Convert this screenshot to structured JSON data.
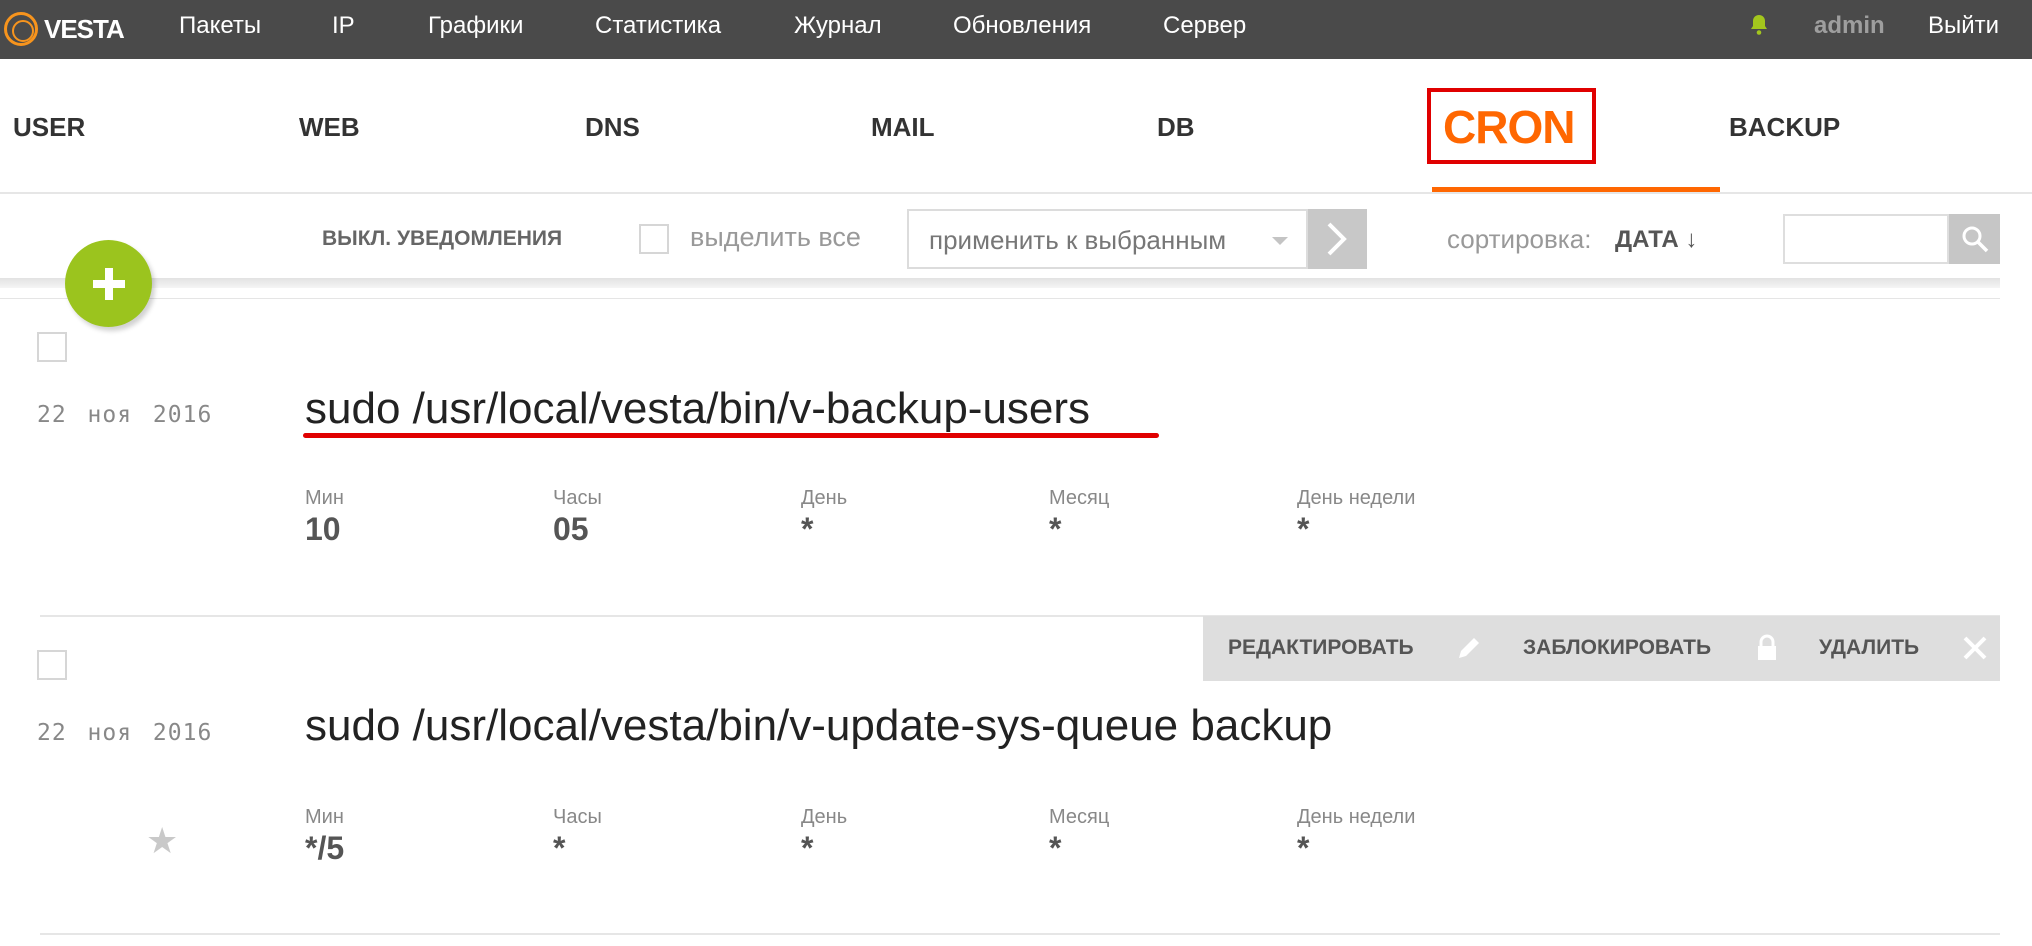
{
  "topbar": {
    "logo_text": "VESTA",
    "nav": [
      "Пакеты",
      "IP",
      "Графики",
      "Статистика",
      "Журнал",
      "Обновления",
      "Сервер"
    ],
    "user": "admin",
    "logout": "Выйти"
  },
  "tabs": {
    "user": "USER",
    "web": "WEB",
    "dns": "DNS",
    "mail": "MAIL",
    "db": "DB",
    "cron": "CRON",
    "backup": "BACKUP",
    "active": "CRON"
  },
  "toolbar": {
    "notifications": "ВЫКЛ. УВЕДОМЛЕНИЯ",
    "select_all": "выделить все",
    "apply_selected": "применить к выбранным",
    "sort_label": "сортировка:",
    "sort_value": "ДАТА ↓",
    "search_value": ""
  },
  "field_labels": {
    "min": "Мин",
    "hour": "Часы",
    "day": "День",
    "month": "Месяц",
    "weekday": "День недели"
  },
  "jobs": [
    {
      "date": "22 ноя 2016",
      "command": "sudo /usr/local/vesta/bin/v-backup-users",
      "min": "10",
      "hour": "05",
      "day": "*",
      "month": "*",
      "weekday": "*"
    },
    {
      "date": "22 ноя 2016",
      "command": "sudo /usr/local/vesta/bin/v-update-sys-queue backup",
      "min": "*/5",
      "hour": "*",
      "day": "*",
      "month": "*",
      "weekday": "*",
      "star": "★"
    }
  ],
  "row_actions": {
    "edit": "РЕДАКТИРОВАТЬ",
    "suspend": "ЗАБЛОКИРОВАТЬ",
    "delete": "УДАЛИТЬ"
  },
  "colors": {
    "topbar_bg": "#4a4a4a",
    "accent_orange": "#ff6701",
    "add_green": "#9bc41e",
    "highlight_red": "#e00000"
  }
}
